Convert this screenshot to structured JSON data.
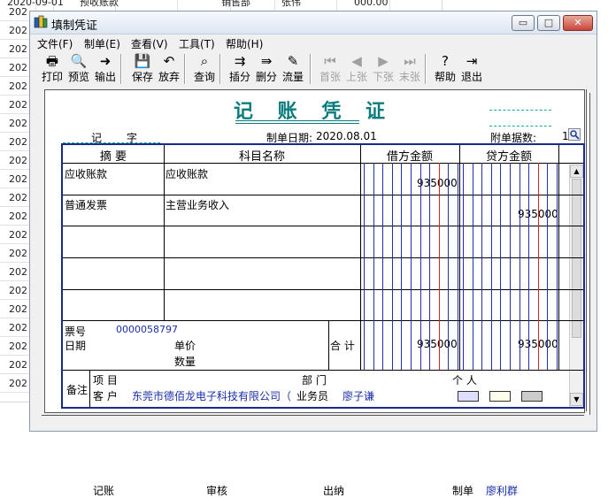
{
  "background_sheet": {
    "rows": [
      "202",
      "202",
      "202",
      "202",
      "202",
      "202",
      "202",
      "202",
      "202",
      "202",
      "202",
      "202",
      "202",
      "202",
      "202",
      "202",
      "202",
      "202",
      "202",
      "202",
      "202"
    ],
    "first_row_fragments": [
      "2020-09-01",
      "预收账款",
      "销售部",
      "张伟",
      "000.00"
    ]
  },
  "window": {
    "title": "填制凭证",
    "controls": {
      "minimize": "▭",
      "maximize": "□",
      "close": "✕"
    }
  },
  "menu": [
    "文件(F)",
    "制单(E)",
    "查看(V)",
    "工具(T)",
    "帮助(H)"
  ],
  "toolbar": [
    {
      "label": "打印",
      "icon": "printer-icon",
      "glyph": "🖶",
      "enabled": true
    },
    {
      "label": "预览",
      "icon": "preview-icon",
      "glyph": "🔍",
      "enabled": true
    },
    {
      "label": "输出",
      "icon": "export-icon",
      "glyph": "➜",
      "enabled": true
    },
    {
      "label": "保存",
      "icon": "save-icon",
      "glyph": "💾",
      "enabled": true
    },
    {
      "label": "放弃",
      "icon": "undo-icon",
      "glyph": "↶",
      "enabled": true
    },
    {
      "label": "查询",
      "icon": "binoculars-icon",
      "glyph": "⌕",
      "enabled": true
    },
    {
      "label": "插分",
      "icon": "insert-row-icon",
      "glyph": "⇉",
      "enabled": true
    },
    {
      "label": "删分",
      "icon": "delete-row-icon",
      "glyph": "⇛",
      "enabled": true
    },
    {
      "label": "流量",
      "icon": "cashflow-icon",
      "glyph": "✎",
      "enabled": true
    },
    {
      "label": "首张",
      "icon": "first-record-icon",
      "glyph": "⏮",
      "enabled": false
    },
    {
      "label": "上张",
      "icon": "prev-record-icon",
      "glyph": "◀",
      "enabled": false
    },
    {
      "label": "下张",
      "icon": "next-record-icon",
      "glyph": "▶",
      "enabled": false
    },
    {
      "label": "末张",
      "icon": "last-record-icon",
      "glyph": "⏭",
      "enabled": false
    },
    {
      "label": "帮助",
      "icon": "help-icon",
      "glyph": "?",
      "enabled": true
    },
    {
      "label": "退出",
      "icon": "exit-icon",
      "glyph": "⇥",
      "enabled": true
    }
  ],
  "voucher": {
    "title": "记 账 凭 证",
    "type_label": "记",
    "number_label": "字",
    "date_label": "制单日期:",
    "date": "2020.08.01",
    "attachments_label": "附单据数:",
    "attachments": "1",
    "columns": [
      "摘 要",
      "科目名称",
      "借方金额",
      "贷方金额"
    ],
    "entries": [
      {
        "summary": "应收账款",
        "account": "应收账款",
        "debit": "935000",
        "credit": ""
      },
      {
        "summary": "普通发票",
        "account": "主营业务收入",
        "debit": "",
        "credit": "935000"
      },
      {
        "summary": "",
        "account": "",
        "debit": "",
        "credit": ""
      },
      {
        "summary": "",
        "account": "",
        "debit": "",
        "credit": ""
      },
      {
        "summary": "",
        "account": "",
        "debit": "",
        "credit": ""
      }
    ],
    "ticket_label": "票号",
    "ticket_no": "0000058797",
    "date_row_label": "日期",
    "unit_price_label": "单价",
    "quantity_label": "数量",
    "total_label": "合 计",
    "total_debit": "935000",
    "total_credit": "935000",
    "remarks_label": "备注",
    "project_label": "项  目",
    "department_label": "部  门",
    "personal_label": "个  人",
    "customer_label": "客  户",
    "customer": "东莞市德佰龙电子科技有限公司（",
    "salesperson_label": "业务员",
    "salesperson": "廖子谦"
  },
  "footer": {
    "bookkeeper_label": "记账",
    "auditor_label": "审核",
    "cashier_label": "出纳",
    "preparer_label": "制单",
    "preparer": "廖利群"
  }
}
